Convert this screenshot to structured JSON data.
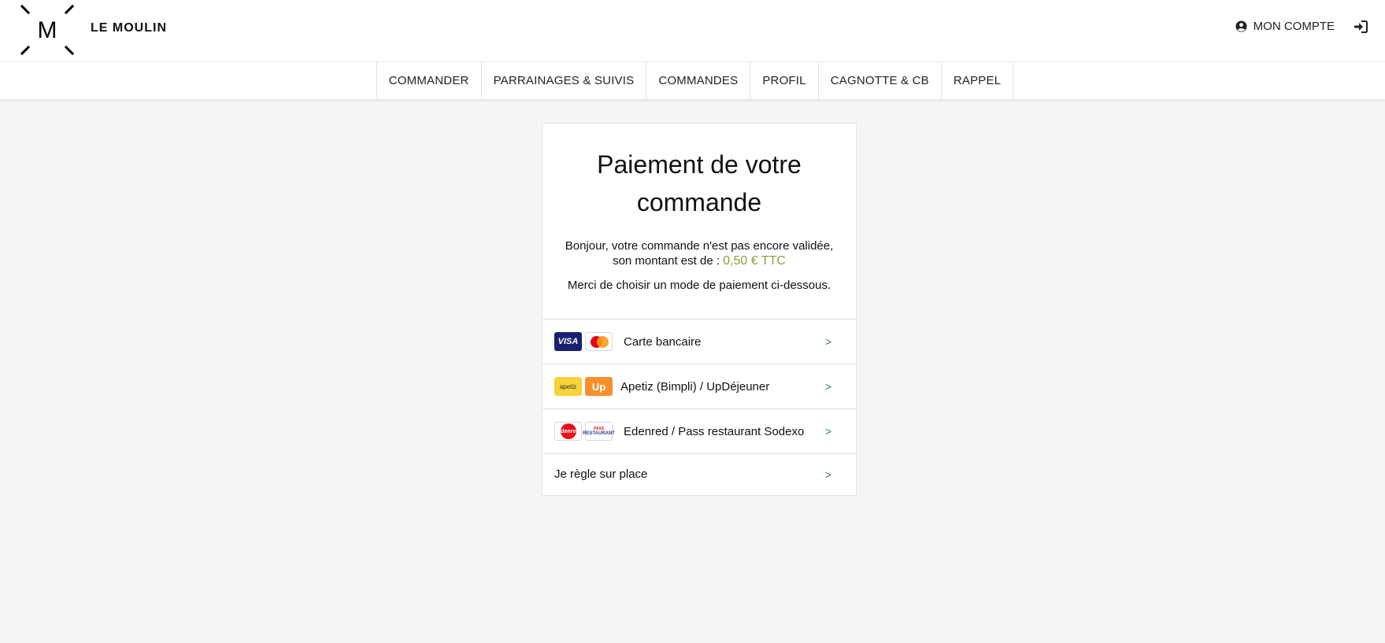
{
  "brand": {
    "name": "LE MOULIN",
    "logo_letter": "M"
  },
  "account": {
    "label": "MON COMPTE",
    "user_icon": "user-circle-icon",
    "login_icon": "sign-in-icon"
  },
  "nav": {
    "items": [
      {
        "label": "COMMANDER"
      },
      {
        "label": "PARRAINAGES & SUIVIS"
      },
      {
        "label": "COMMANDES"
      },
      {
        "label": "PROFIL"
      },
      {
        "label": "CAGNOTTE & CB"
      },
      {
        "label": "RAPPEL"
      }
    ]
  },
  "payment": {
    "title": "Paiement de votre commande",
    "intro": "Bonjour, votre commande n'est pas encore validée, son montant est de :",
    "amount": "0,50 € TTC",
    "instruction": "Merci de choisir un mode de paiement ci-dessous.",
    "methods": [
      {
        "label": "Carte bancaire",
        "logos": [
          "VISA",
          "mastercard"
        ],
        "arrow": ">"
      },
      {
        "label": "Apetiz (Bimpli) / UpDéjeuner",
        "logos": [
          "apetiz",
          "Up"
        ],
        "arrow": ">"
      },
      {
        "label": "Edenred / Pass restaurant Sodexo",
        "logos": [
          "Edenred",
          "RESTAURANT"
        ],
        "arrow": ">"
      },
      {
        "label": "Je règle sur place",
        "arrow": ">"
      }
    ]
  },
  "colors": {
    "amount": "#8ba23c",
    "arrow": "#2e7d4f",
    "background": "#f5f5f3"
  }
}
